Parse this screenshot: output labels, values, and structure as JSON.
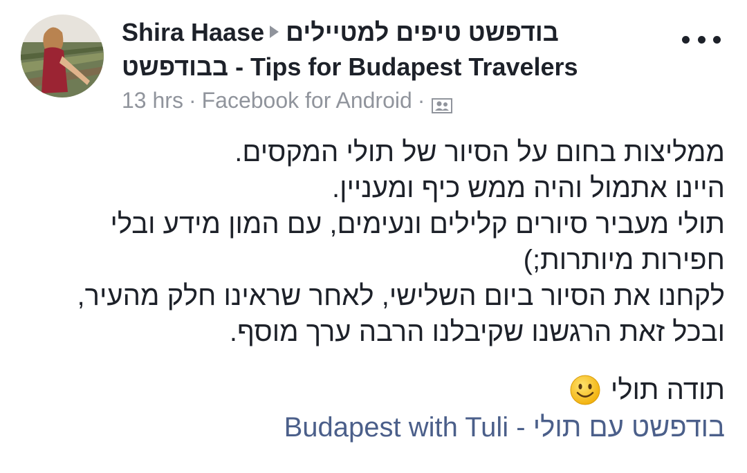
{
  "post": {
    "author": "Shira Haase",
    "group_name_line1": "בודפשט טיפים למטיילים",
    "group_name_line2": "בבודפשט - Tips for Budapest Travelers",
    "time": "13 hrs",
    "source": "Facebook for Android",
    "separator": "·",
    "audience_icon": "group-members-icon",
    "more_icon": "more-options-icon",
    "body_lines": [
      "ממליצות בחום על הסיור של תולי המקסים.",
      "היינו אתמול והיה ממש כיף ומעניין.",
      "תולי מעביר סיורים קלילים ונעימים, עם המון מידע ובלי",
      "חפירות מיותרות;)",
      "לקחנו את הסיור ביום השלישי, לאחר שראינו חלק מהעיר,",
      "ובכל זאת הרגשנו שקיבלנו הרבה ערך מוסף."
    ],
    "thanks": "תודה תולי",
    "emoji": "smiley-emoji",
    "tagged_page": "Budapest with Tuli - בודפשט עם תולי"
  },
  "colors": {
    "text": "#1d2129",
    "meta": "#90949c",
    "link": "#4b5f8a",
    "emoji": "#f7c21a"
  }
}
